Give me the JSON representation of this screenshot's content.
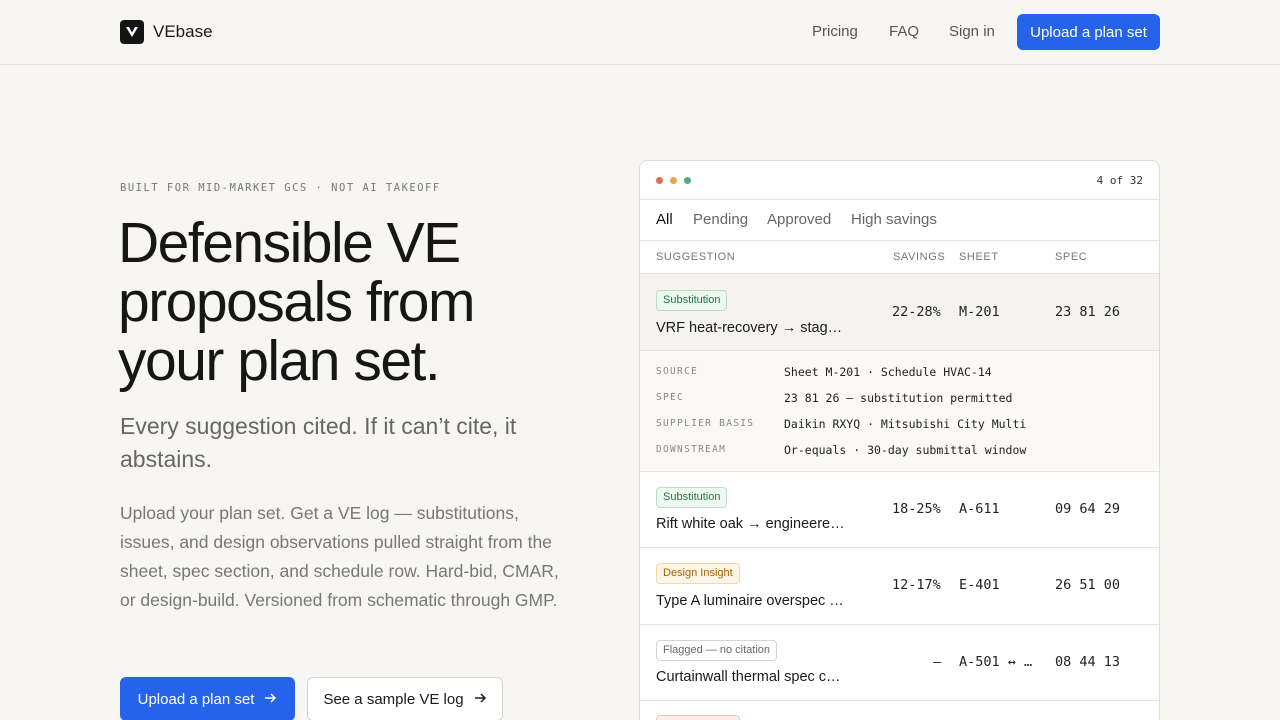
{
  "nav": {
    "brand": "VEbase",
    "links": [
      "Pricing",
      "FAQ",
      "Sign in"
    ],
    "cta": "Upload a plan set"
  },
  "hero": {
    "eyebrow": "BUILT FOR MID-MARKET GCS · NOT AI TAKEOFF",
    "headline_lines": [
      "Defensible VE",
      "proposals from",
      "your plan set."
    ],
    "subhead": "Every suggestion cited. If it can’t cite, it abstains.",
    "body": "Upload your plan set. Get a VE log — substitutions, issues, and design observations pulled straight from the sheet, spec section, and schedule row. Hard-bid, CMAR, or design-build. Versioned from schematic through GMP.",
    "primary_cta": "Upload a plan set",
    "secondary_cta": "See a sample VE log"
  },
  "panel": {
    "counter": "4 of 32",
    "window_dot_colors": [
      "#e06c5f",
      "#e3a652",
      "#4fae7a"
    ],
    "tabs": [
      "All",
      "Pending",
      "Approved",
      "High savings"
    ],
    "active_tab": "All",
    "columns": [
      "SUGGESTION",
      "SAVINGS",
      "SHEET",
      "SPEC"
    ],
    "rows": [
      {
        "badge": "Substitution",
        "title": "VRF heat-recovery → stag…",
        "savings": "22-28%",
        "sheet": "M-201",
        "spec": "23 81 26"
      },
      {
        "badge": "Substitution",
        "title": "Rift white oak → engineere…",
        "savings": "18-25%",
        "sheet": "A-611",
        "spec": "09 64 29"
      },
      {
        "badge": "Design Insight",
        "title": "Type A luminaire overspec …",
        "savings": "12-17%",
        "sheet": "E-401",
        "spec": "26 51 00"
      },
      {
        "badge": "Flagged — no citation",
        "title": "Curtainwall thermal spec c…",
        "savings": "—",
        "sheet": "A-501 ↔ …",
        "spec": "08 44 13"
      }
    ],
    "detail": [
      {
        "label": "SOURCE",
        "value": "Sheet M-201 · Schedule HVAC-14"
      },
      {
        "label": "SPEC",
        "value": "23 81 26 — substitution permitted"
      },
      {
        "label": "SUPPLIER BASIS",
        "value": "Daikin RXYQ · Mitsubishi City Multi"
      },
      {
        "label": "DOWNSTREAM",
        "value": "Or-equals · 30-day submittal window"
      }
    ]
  }
}
